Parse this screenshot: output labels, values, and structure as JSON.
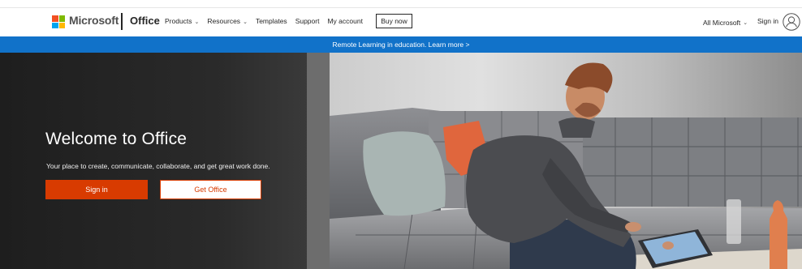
{
  "header": {
    "brand": "Microsoft",
    "product": "Office",
    "nav": [
      {
        "label": "Products",
        "dropdown": true
      },
      {
        "label": "Resources",
        "dropdown": true
      },
      {
        "label": "Templates",
        "dropdown": false
      },
      {
        "label": "Support",
        "dropdown": false
      },
      {
        "label": "My account",
        "dropdown": false
      }
    ],
    "buy_label": "Buy now",
    "all_microsoft_label": "All Microsoft",
    "sign_in_label": "Sign in",
    "logo_colors": [
      "#f25022",
      "#7fba00",
      "#00a4ef",
      "#ffb900"
    ]
  },
  "banner": {
    "text": "Remote Learning in education. Learn more >",
    "color": "#1172c9"
  },
  "hero": {
    "title": "Welcome to Office",
    "subtitle": "Your place to create, communicate, collaborate, and get great work done.",
    "primary_button": "Sign in",
    "secondary_button": "Get Office",
    "accent_color": "#d83b01"
  }
}
